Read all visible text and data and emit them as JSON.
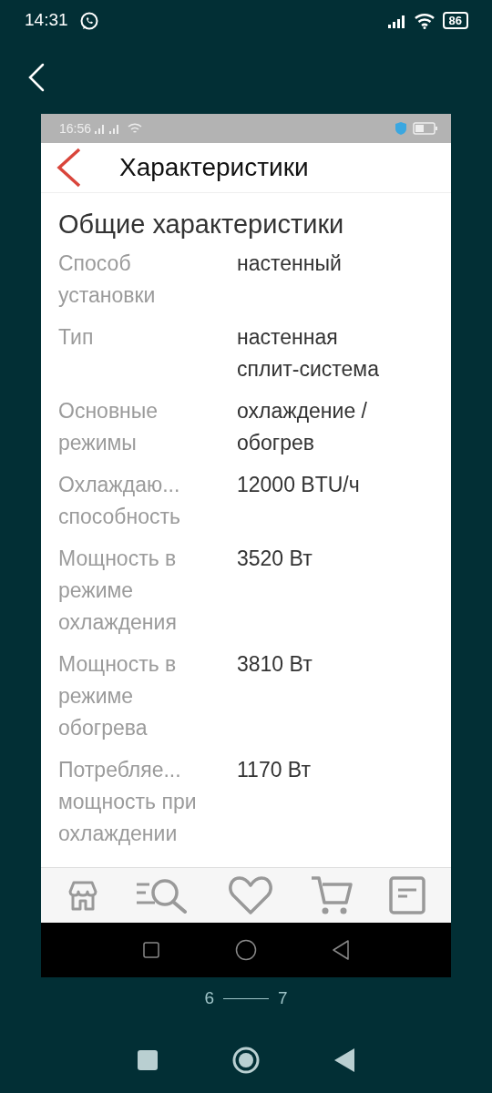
{
  "status_bar": {
    "time": "14:31",
    "battery": "86"
  },
  "screenshot": {
    "status_bar": {
      "time": "16:56"
    },
    "title": "Характеристики",
    "section_title": "Общие характеристики",
    "specs": [
      {
        "label": "Способ установки",
        "value": "настенный"
      },
      {
        "label": "Тип",
        "value": "настенная сплит-система"
      },
      {
        "label": "Основные режимы",
        "value": "охлаждение / обогрев"
      },
      {
        "label": "Охлаждаю... способность",
        "value": "12000 BTU/ч"
      },
      {
        "label": "Мощность в режиме охлаждения",
        "value": "3520 Вт"
      },
      {
        "label": "Мощность в режиме обогрева",
        "value": "3810 Вт"
      },
      {
        "label": "Потребляе... мощность при охлаждении",
        "value": "1170 Вт"
      }
    ]
  },
  "pager": {
    "current": "6",
    "total": "7"
  }
}
